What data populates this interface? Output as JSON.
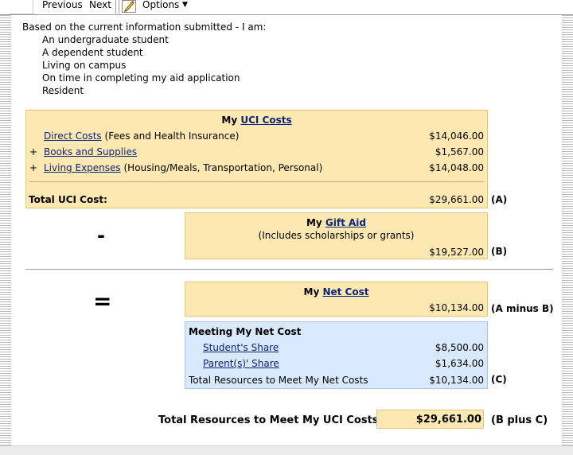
{
  "toolbar": {
    "previous_label": "Previous",
    "next_label": "Next",
    "options_label": "Options",
    "dropdown_arrow": "▼"
  },
  "status": {
    "intro": "Based on the current information submitted - I am:",
    "items": [
      "An undergraduate student",
      "A dependent student",
      "Living on campus",
      "On time in completing my aid application",
      "Resident"
    ]
  },
  "costs": {
    "title_prefix": "My",
    "title_link": "UCI Costs",
    "rows": [
      {
        "prefix": "",
        "link": "Direct Costs",
        "note": "(Fees and Health Insurance)",
        "amount": "$14,046.00"
      },
      {
        "prefix": "+",
        "link": "Books and Supplies",
        "note": "",
        "amount": "$1,567.00"
      },
      {
        "prefix": "+",
        "link": "Living Expenses",
        "note": "(Housing/Meals, Transportation, Personal)",
        "amount": "$14,048.00"
      }
    ],
    "total_label": "Total UCI Cost:",
    "total_amount": "$29,661.00",
    "marker": "(A)"
  },
  "minus_symbol": "-",
  "gift_aid": {
    "title_prefix": "My",
    "title_link": "Gift Aid",
    "subtitle": "(Includes scholarships or grants)",
    "amount": "$19,527.00",
    "marker": "(B)"
  },
  "equals_symbol": "=",
  "net_cost": {
    "title_prefix": "My",
    "title_link": "Net Cost",
    "amount": "$10,134.00",
    "marker": "(A minus B)"
  },
  "meeting": {
    "title": "Meeting My Net Cost",
    "rows": [
      {
        "link": "Student's Share",
        "amount": "$8,500.00"
      },
      {
        "link": "Parent(s)' Share",
        "amount": "$1,634.00"
      }
    ],
    "total_label": "Total Resources to Meet My Net Costs",
    "total_amount": "$10,134.00",
    "marker": "(C)"
  },
  "grand_total": {
    "label": "Total Resources to Meet My UCI Costs",
    "amount": "$29,661.00",
    "marker": "(B plus C)"
  }
}
